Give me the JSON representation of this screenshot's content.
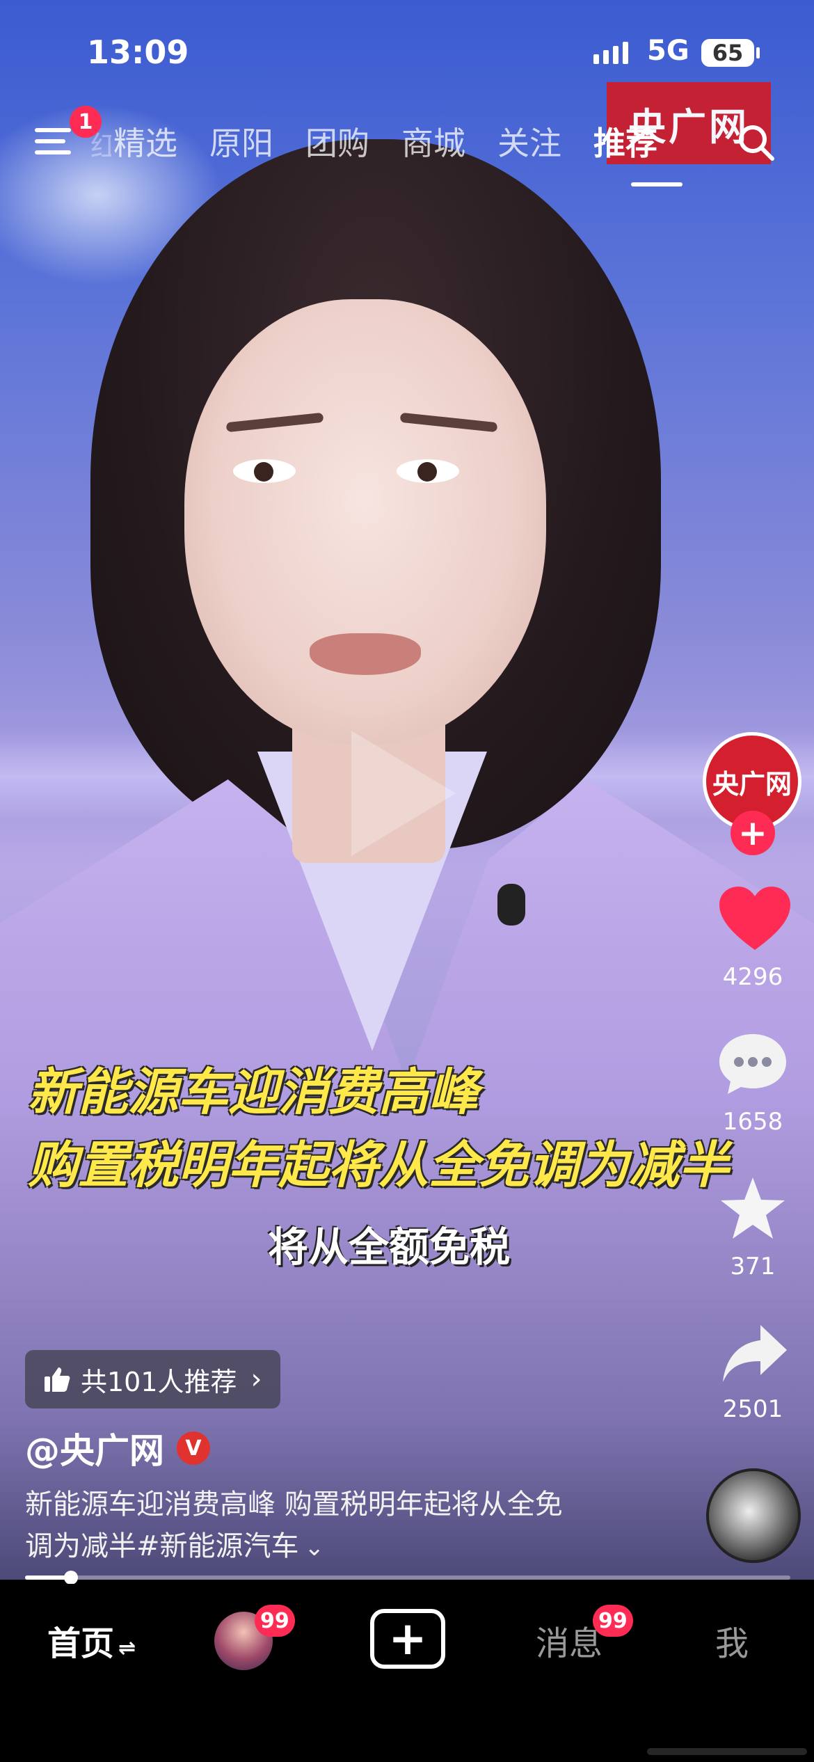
{
  "status_bar": {
    "time": "13:09",
    "network": "5G",
    "battery": "65"
  },
  "top_nav": {
    "menu_badge": "1",
    "partial_tab": "红",
    "tabs": [
      "精选",
      "原阳",
      "团购",
      "商城",
      "关注",
      "推荐"
    ],
    "active_tab": "推荐",
    "watermark_logo": "央广网"
  },
  "video": {
    "headline_line1": "新能源车迎消费高峰",
    "headline_line2": "购置税明年起将从全免调为减半",
    "subtitle": "将从全额免税"
  },
  "right_rail": {
    "author_avatar_text": "央广网",
    "follow_label": "+",
    "likes": "4296",
    "comments": "1658",
    "favorites": "371",
    "shares": "2501"
  },
  "info": {
    "recommend_chip": "共101人推荐",
    "author": "@央广网",
    "verified_mark": "V",
    "description_line1": "新能源车迎消费高峰 购置税明年起将从全免",
    "description_line2": "调为减半#新能源汽车",
    "progress": 0.06
  },
  "tabbar": {
    "home": "首页",
    "friends_badge": "99",
    "create": "+",
    "messages": "消息",
    "messages_badge": "99",
    "me": "我"
  },
  "colors": {
    "accent": "#fe2c55",
    "caption_yellow": "#ffe94a",
    "brand_red": "#cc1e2c"
  }
}
